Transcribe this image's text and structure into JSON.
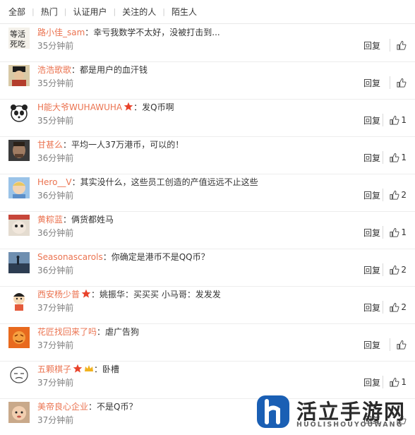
{
  "tabs": [
    "全部",
    "热门",
    "认证用户",
    "关注的人",
    "陌生人"
  ],
  "reply_label": "回复",
  "comments": [
    {
      "user": "路小佳_sam",
      "text": "：幸亏我数学不太好，没被打击到...",
      "time": "35分钟前",
      "likes": "",
      "avatar": "calligraphy-avatar"
    },
    {
      "user": "浩浩歌歌",
      "text": "：都是用户的血汗钱",
      "time": "35分钟前",
      "likes": "",
      "avatar": "official-avatar"
    },
    {
      "user": "H能大爷WUHAWUHA",
      "text": "：发Q币啊",
      "time": "35分钟前",
      "likes": "1",
      "avatar": "panda-avatar",
      "badge": "star"
    },
    {
      "user": "甘甚么",
      "text": "：平均一人37万港币，可以的！",
      "time": "36分钟前",
      "likes": "1",
      "avatar": "man-avatar"
    },
    {
      "user": "Hero__V",
      "text": "：其实没什么，这些员工创造的产值远远不止这些",
      "time": "36分钟前",
      "likes": "2",
      "avatar": "kid-avatar"
    },
    {
      "user": "黄粽蓝",
      "text": "：俩货都姓马",
      "time": "36分钟前",
      "likes": "1",
      "avatar": "animal-avatar"
    },
    {
      "user": "Seasonascarols",
      "text": "：你确定是港币不是QQ币？",
      "time": "36分钟前",
      "likes": "2",
      "avatar": "landscape-avatar"
    },
    {
      "user": "西安杨少普",
      "text": "：姚振华：买买买   小马哥：发发发",
      "time": "37分钟前",
      "likes": "2",
      "avatar": "cartoon-avatar",
      "badge": "star"
    },
    {
      "user": "花匠找回来了吗",
      "text": "：虐广告狗",
      "time": "37分钟前",
      "likes": "",
      "avatar": "orange-avatar"
    },
    {
      "user": "五颗棋子",
      "text": "：卧槽",
      "time": "37分钟前",
      "likes": "1",
      "avatar": "face-avatar",
      "badge": "star-crown"
    },
    {
      "user": "美帝良心企业",
      "text": "：不是Q币？",
      "time": "37分钟前",
      "likes": "",
      "avatar": "baby-avatar"
    }
  ],
  "watermark": {
    "title": "活立手游网",
    "subtitle": "HUOLISHOUYOUWANG"
  },
  "colors": {
    "username": "#eb7350",
    "time": "#808080",
    "divider": "#ededed"
  }
}
